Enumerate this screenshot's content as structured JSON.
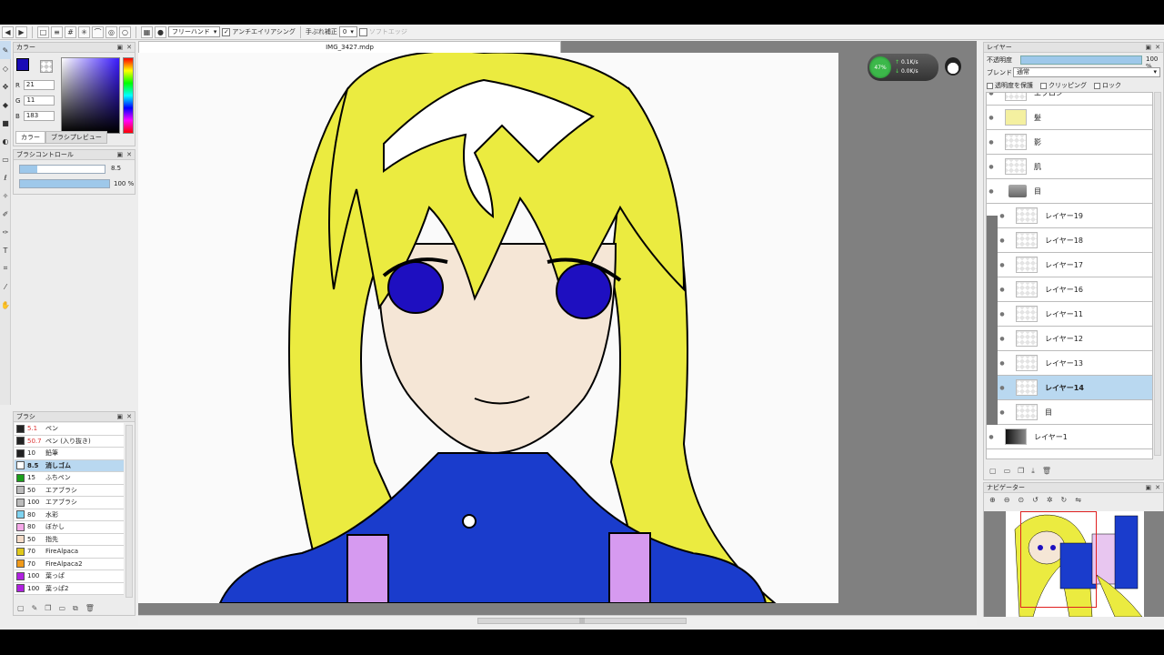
{
  "toolbar": {
    "brush_mode": "フリーハンド",
    "antialias_label": "アンチエイリアシング",
    "stabilizer_label": "手ぶれ補正",
    "stabilizer_value": "0",
    "soft_edge_label": "ソフトエッジ"
  },
  "color_panel": {
    "title": "カラー",
    "r_label": "R",
    "r_value": "21",
    "g_label": "G",
    "g_value": "11",
    "b_label": "B",
    "b_value": "183",
    "tab_color": "カラー",
    "tab_preview": "ブラシプレビュー",
    "current_color": "#1a0bb7"
  },
  "brush_control": {
    "title": "ブラシコントロール",
    "size_value": "8.5",
    "opacity_value": "100 %",
    "size_fraction": 0.2,
    "opacity_fraction": 1.0
  },
  "brush_panel": {
    "title": "ブラシ",
    "items": [
      {
        "size": "5.1",
        "name": "ペン",
        "color": "#222222"
      },
      {
        "size": "50.7",
        "name": "ペン (入り抜き)",
        "color": "#222222"
      },
      {
        "size": "10",
        "name": "鉛筆",
        "color": "#222222"
      },
      {
        "size": "8.5",
        "name": "消しゴム",
        "color": "#ffffff"
      },
      {
        "size": "15",
        "name": "ふちペン",
        "color": "#1aa01a"
      },
      {
        "size": "50",
        "name": "エアブラシ",
        "color": "#bbbbbb"
      },
      {
        "size": "100",
        "name": "エアブラシ",
        "color": "#bbbbbb"
      },
      {
        "size": "80",
        "name": "水彩",
        "color": "#7fd3f0"
      },
      {
        "size": "80",
        "name": "ぼかし",
        "color": "#f5a8e8"
      },
      {
        "size": "50",
        "name": "指先",
        "color": "#f5dcc8"
      },
      {
        "size": "70",
        "name": "FireAlpaca",
        "color": "#e0c81a"
      },
      {
        "size": "70",
        "name": "FireAlpaca2",
        "color": "#f09a1a"
      },
      {
        "size": "100",
        "name": "葉っぱ",
        "color": "#b020e0"
      },
      {
        "size": "100",
        "name": "葉っぱ2",
        "color": "#b020e0"
      }
    ]
  },
  "document": {
    "tab_title": "IMG_3427.mdp"
  },
  "net_widget": {
    "percent": "47%",
    "up": "0.1K/s",
    "down": "0.0K/s"
  },
  "layer_panel": {
    "title": "レイヤー",
    "opacity_label": "不透明度",
    "opacity_value": "100 %",
    "blend_label": "ブレンド",
    "blend_value": "通常",
    "protect_label": "透明度を保護",
    "clipping_label": "クリッピング",
    "lock_label": "ロック",
    "layers": [
      {
        "name": "エプロン",
        "kind": "layer"
      },
      {
        "name": "髪",
        "kind": "hair"
      },
      {
        "name": "影",
        "kind": "layer"
      },
      {
        "name": "肌",
        "kind": "layer"
      },
      {
        "name": "目",
        "kind": "folder"
      },
      {
        "name": "レイヤー19",
        "kind": "child"
      },
      {
        "name": "レイヤー18",
        "kind": "child"
      },
      {
        "name": "レイヤー17",
        "kind": "child"
      },
      {
        "name": "レイヤー16",
        "kind": "child"
      },
      {
        "name": "レイヤー11",
        "kind": "child"
      },
      {
        "name": "レイヤー12",
        "kind": "child"
      },
      {
        "name": "レイヤー13",
        "kind": "child"
      },
      {
        "name": "レイヤー14",
        "kind": "child-selected"
      },
      {
        "name": "目",
        "kind": "child"
      },
      {
        "name": "レイヤー1",
        "kind": "dark"
      }
    ]
  },
  "navigator": {
    "title": "ナビゲーター"
  }
}
